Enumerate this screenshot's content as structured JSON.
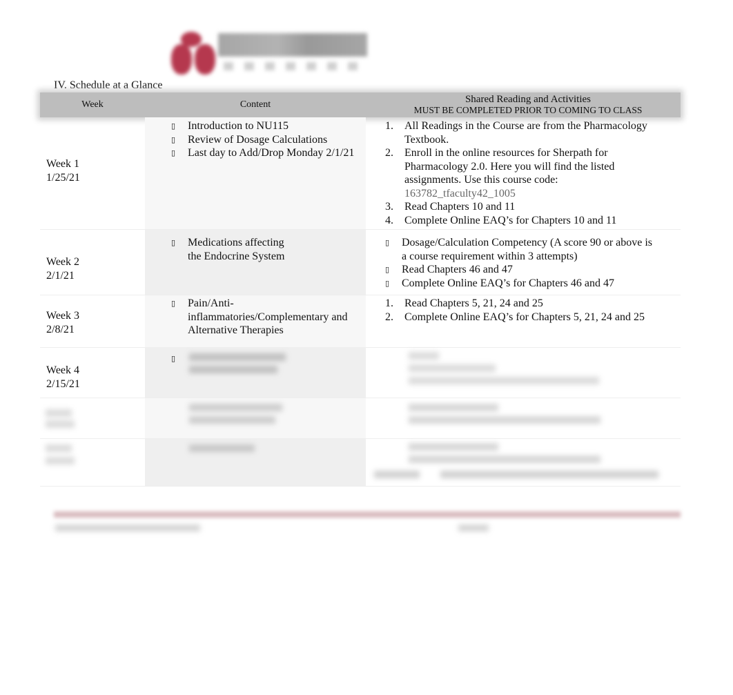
{
  "logo": {
    "name": "Trocaire College logo",
    "brand_color": "#b5384e"
  },
  "section_title": "IV. Schedule at a Glance",
  "table": {
    "headers": {
      "week": "Week",
      "content": "Content",
      "shared": "Shared Reading and Activities",
      "shared_sub": "MUST BE COMPLETED PRIOR TO COMING TO CLASS"
    },
    "rows": [
      {
        "week": "Week 1",
        "date": "1/25/21",
        "content_bullet": "symbol-bullet-icon",
        "content": [
          "Introduction to NU115",
          "Review of Dosage Calculations",
          "Last day to Add/Drop Monday 2/1/21"
        ],
        "shared_style": "numbered",
        "shared": [
          "All Readings in the Course are from the Pharmacology Textbook.",
          "Enroll in the online resources for Sherpath for Pharmacology 2.0.  Here you will find the listed assignments.  Use this course code:",
          "Read Chapters 10 and 11",
          "Complete Online EAQ’s for Chapters 10 and 11"
        ],
        "course_code": "163782_tfaculty42_1005"
      },
      {
        "week": "Week 2",
        "date": "2/1/21",
        "content": [
          "Medications affecting the Endocrine System"
        ],
        "shared_style": "bullet",
        "shared": [
          "Dosage/Calculation Competency (A score 90 or above is a course requirement within 3 attempts)",
          "Read Chapters 46 and 47",
          "Complete Online EAQ’s for Chapters 46 and 47"
        ]
      },
      {
        "week": "Week 3",
        "date": "2/8/21",
        "content": [
          "Pain/Anti-inflammatories/Complementary and Alternative Therapies"
        ],
        "shared_style": "numbered",
        "shared": [
          "Read Chapters 5, 21, 24 and 25",
          "Complete Online EAQ’s for Chapters 5, 21, 24 and 25"
        ]
      },
      {
        "week": "Week 4",
        "date": "2/15/21",
        "content_blurred": true,
        "shared_blurred": true
      },
      {
        "week_blurred": true,
        "content_blurred": true,
        "shared_blurred": true
      },
      {
        "week_blurred": true,
        "content_blurred": true,
        "shared_blurred": true
      }
    ]
  },
  "footer": {
    "blurred": true
  }
}
